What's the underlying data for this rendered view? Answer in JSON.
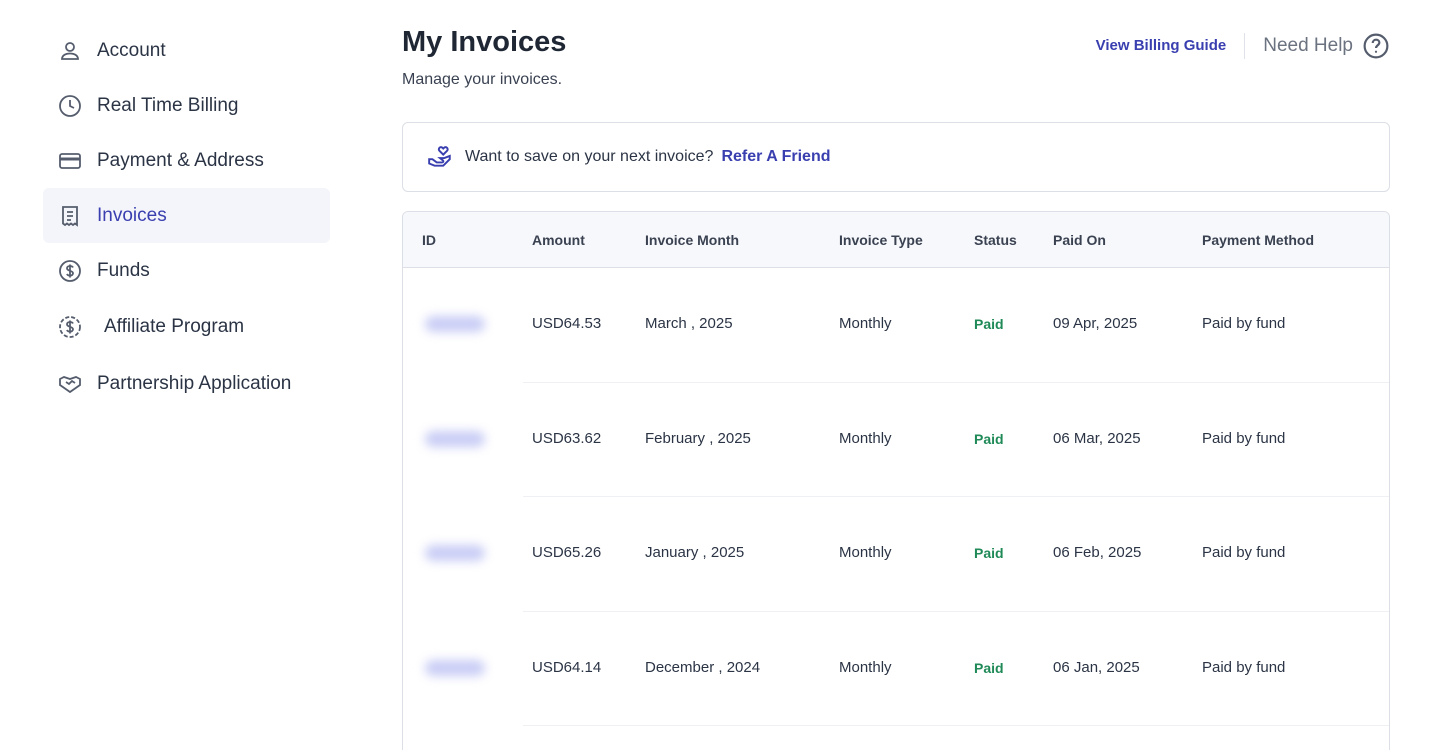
{
  "sidebar": {
    "items": [
      {
        "label": "Account",
        "icon": "user-icon",
        "active": false
      },
      {
        "label": "Real Time Billing",
        "icon": "clock-icon",
        "active": false
      },
      {
        "label": "Payment & Address",
        "icon": "credit-card-icon",
        "active": false
      },
      {
        "label": "Invoices",
        "icon": "receipt-icon",
        "active": true
      },
      {
        "label": "Funds",
        "icon": "dollar-circle-icon",
        "active": false
      },
      {
        "label": "Affiliate Program",
        "icon": "affiliate-dollar-icon",
        "active": false
      },
      {
        "label": "Partnership Application",
        "icon": "handshake-icon",
        "active": false
      }
    ]
  },
  "header": {
    "title": "My Invoices",
    "subtitle": "Manage your invoices.",
    "billing_guide": "View Billing Guide",
    "need_help": "Need Help"
  },
  "referral": {
    "text": "Want to save on your next invoice?",
    "link": "Refer A Friend"
  },
  "table": {
    "columns": [
      "ID",
      "Amount",
      "Invoice Month",
      "Invoice Type",
      "Status",
      "Paid On",
      "Payment Method"
    ],
    "rows": [
      {
        "amount": "USD64.53",
        "month": "March , 2025",
        "type": "Monthly",
        "status": "Paid",
        "paid_on": "09 Apr, 2025",
        "method": "Paid by fund"
      },
      {
        "amount": "USD63.62",
        "month": "February , 2025",
        "type": "Monthly",
        "status": "Paid",
        "paid_on": "06 Mar, 2025",
        "method": "Paid by fund"
      },
      {
        "amount": "USD65.26",
        "month": "January , 2025",
        "type": "Monthly",
        "status": "Paid",
        "paid_on": "06 Feb, 2025",
        "method": "Paid by fund"
      },
      {
        "amount": "USD64.14",
        "month": "December , 2024",
        "type": "Monthly",
        "status": "Paid",
        "paid_on": "06 Jan, 2025",
        "method": "Paid by fund"
      }
    ]
  },
  "colors": {
    "accent": "#3a3fb0",
    "paid": "#1f8a57",
    "active_bg": "#f4f5fa"
  }
}
